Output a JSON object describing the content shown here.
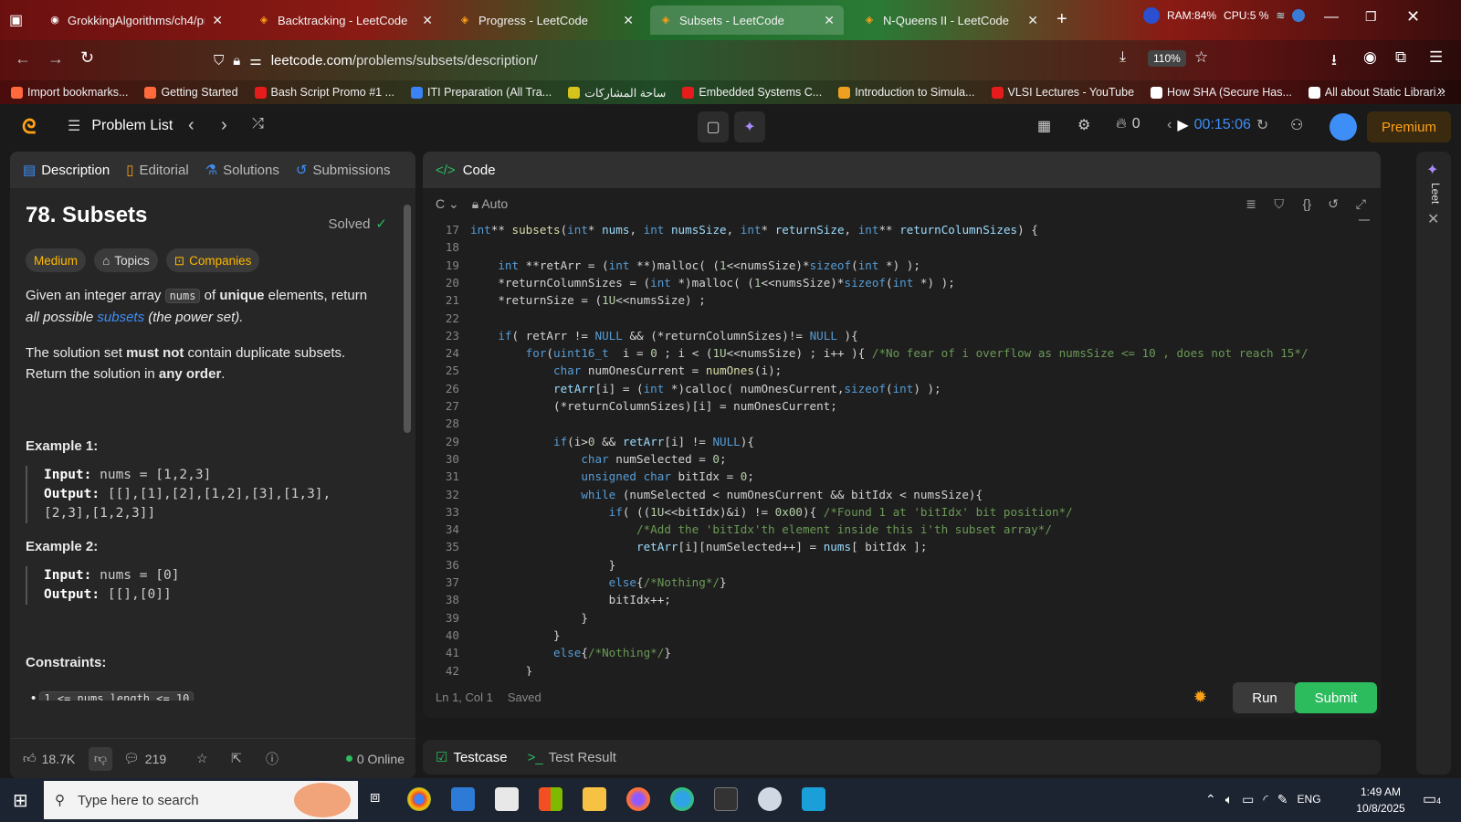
{
  "browser": {
    "tabs": [
      {
        "title": "GrokkingAlgorithms/ch4/prob1",
        "active": false
      },
      {
        "title": "Backtracking - LeetCode",
        "active": false
      },
      {
        "title": "Progress - LeetCode",
        "active": false
      },
      {
        "title": "Subsets - LeetCode",
        "active": true
      },
      {
        "title": "N-Queens II - LeetCode",
        "active": false
      }
    ],
    "sys": {
      "ram": "RAM:84%",
      "cpu": "CPU:5 %"
    },
    "url_domain": "leetcode.com",
    "url_path": "/problems/subsets/description/",
    "zoom": "110%",
    "bookmarks": [
      "Import bookmarks...",
      "Getting Started",
      "Bash Script Promo #1 ...",
      "ITI Preparation (All Tra...",
      "ساحة المشاركات",
      "Embedded Systems C...",
      "Introduction to Simula...",
      "VLSI Lectures - YouTube",
      "How SHA (Secure Has...",
      "All about Static Librari..."
    ]
  },
  "lc_header": {
    "problem_list": "Problem List",
    "streak": "0",
    "timer": "00:15:06",
    "premium": "Premium"
  },
  "left": {
    "tabs": [
      "Description",
      "Editorial",
      "Solutions",
      "Submissions"
    ],
    "title": "78. Subsets",
    "solved": "Solved",
    "difficulty": "Medium",
    "topics": "Topics",
    "companies": "Companies",
    "para1_a": "Given an integer array ",
    "para1_code": "nums",
    "para1_b": " of ",
    "para1_bold": "unique",
    "para1_c": " elements, return",
    "para1_d": "all possible ",
    "para1_link": "subsets",
    "para1_e": " (the power set).",
    "para2_a": "The solution set ",
    "para2_bold": "must not",
    "para2_b": " contain duplicate subsets.",
    "para2_c": "Return the solution in ",
    "para2_bold2": "any order",
    "para2_d": ".",
    "ex1_title": "Example 1:",
    "ex1_input_label": "Input:",
    "ex1_input": " nums = [1,2,3]",
    "ex1_output_label": "Output:",
    "ex1_output1": " [[],[1],[2],[1,2],[3],[1,3],",
    "ex1_output2": "[2,3],[1,2,3]]",
    "ex2_title": "Example 2:",
    "ex2_input_label": "Input:",
    "ex2_input": " nums = [0]",
    "ex2_output_label": "Output:",
    "ex2_output": " [[],[0]]",
    "constraints": "Constraints:",
    "constraint1": "1 <= nums.length <= 10",
    "likes": "18.7K",
    "comments": "219",
    "online": "0 Online"
  },
  "code": {
    "header": "Code",
    "lang": "C",
    "auto": "Auto",
    "lines": [
      {
        "n": "17",
        "html": "<span class='kw'>int</span>** <span class='fn'>subsets</span>(<span class='kw'>int</span>* <span class='var'>nums</span>, <span class='kw'>int</span> <span class='var'>numsSize</span>, <span class='kw'>int</span>* <span class='var'>returnSize</span>, <span class='kw'>int</span>** <span class='var'>returnColumnSizes</span>) {"
      },
      {
        "n": "18",
        "html": ""
      },
      {
        "n": "19",
        "html": "    <span class='kw'>int</span> **retArr = (<span class='kw'>int</span> **)malloc( (<span class='num'>1</span>&lt;&lt;numsSize)*<span class='kw'>sizeof</span>(<span class='kw'>int</span> *) );"
      },
      {
        "n": "20",
        "html": "    *returnColumnSizes = (<span class='kw'>int</span> *)malloc( (<span class='num'>1</span>&lt;&lt;numsSize)*<span class='kw'>sizeof</span>(<span class='kw'>int</span> *) );"
      },
      {
        "n": "21",
        "html": "    *returnSize = (<span class='num'>1U</span>&lt;&lt;numsSize) ;"
      },
      {
        "n": "22",
        "html": ""
      },
      {
        "n": "23",
        "html": "    <span class='kw'>if</span>( retArr != <span class='kw'>NULL</span> &amp;&amp; (*returnColumnSizes)!= <span class='kw'>NULL</span> ){"
      },
      {
        "n": "24",
        "html": "        <span class='kw'>for</span>(<span class='kw'>uint16_t</span>  i = <span class='num'>0</span> ; i &lt; (<span class='num'>1U</span>&lt;&lt;numsSize) ; i++ ){ <span class='cm'>/*No fear of i overflow as numsSize &lt;= 10 , does not reach 15*/</span>"
      },
      {
        "n": "25",
        "html": "            <span class='kw'>char</span> numOnesCurrent = <span class='fn'>numOnes</span>(i);"
      },
      {
        "n": "26",
        "html": "            <span class='var'>retArr</span>[i] = (<span class='kw'>int</span> *)calloc( numOnesCurrent,<span class='kw'>sizeof</span>(<span class='kw'>int</span>) );"
      },
      {
        "n": "27",
        "html": "            (*returnColumnSizes)[i] = numOnesCurrent;"
      },
      {
        "n": "28",
        "html": ""
      },
      {
        "n": "29",
        "html": "            <span class='kw'>if</span>(i&gt;<span class='num'>0</span> &amp;&amp; <span class='var'>retArr</span>[i] != <span class='kw'>NULL</span>){"
      },
      {
        "n": "30",
        "html": "                <span class='kw'>char</span> numSelected = <span class='num'>0</span>;"
      },
      {
        "n": "31",
        "html": "                <span class='kw'>unsigned char</span> bitIdx = <span class='num'>0</span>;"
      },
      {
        "n": "32",
        "html": "                <span class='kw'>while</span> (numSelected &lt; numOnesCurrent &amp;&amp; bitIdx &lt; numsSize){"
      },
      {
        "n": "33",
        "html": "                    <span class='kw'>if</span>( ((<span class='num'>1U</span>&lt;&lt;bitIdx)&amp;i) != <span class='num'>0x00</span>){ <span class='cm'>/*Found 1 at 'bitIdx' bit position*/</span>"
      },
      {
        "n": "34",
        "html": "                        <span class='cm'>/*Add the 'bitIdx'th element inside this i'th subset array*/</span>"
      },
      {
        "n": "35",
        "html": "                        <span class='var'>retArr</span>[i][numSelected++] = <span class='var'>nums</span>[ bitIdx ];"
      },
      {
        "n": "36",
        "html": "                    }"
      },
      {
        "n": "37",
        "html": "                    <span class='kw'>else</span>{<span class='cm'>/*Nothing*/</span>}"
      },
      {
        "n": "38",
        "html": "                    bitIdx++;"
      },
      {
        "n": "39",
        "html": "                }"
      },
      {
        "n": "40",
        "html": "            }"
      },
      {
        "n": "41",
        "html": "            <span class='kw'>else</span>{<span class='cm'>/*Nothing*/</span>}"
      },
      {
        "n": "42",
        "html": "        }"
      }
    ],
    "cursor": "Ln 1, Col 1",
    "saved": "Saved",
    "run": "Run",
    "submit": "Submit"
  },
  "test": {
    "testcase": "Testcase",
    "result": "Test Result"
  },
  "rightrail": {
    "label": "Leet"
  },
  "taskbar": {
    "search_placeholder": "Type here to search",
    "lang": "ENG",
    "time": "1:49 AM",
    "date": "10/8/2025",
    "notif": "4"
  }
}
